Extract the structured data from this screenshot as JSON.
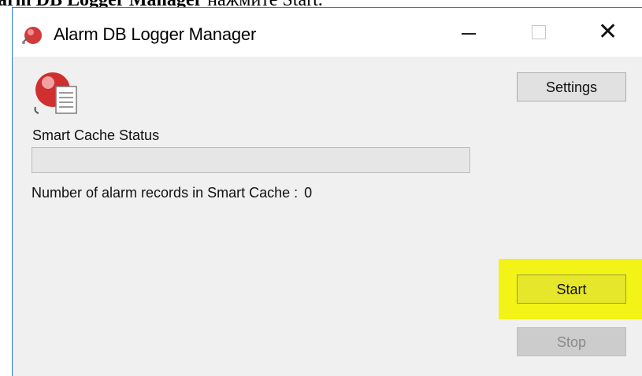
{
  "document": {
    "heading_bold": "arm DB Logger Manager",
    "heading_text": " нажмите Start."
  },
  "window": {
    "title": "Alarm DB Logger Manager",
    "icons": {
      "app": "alarm-bell-icon",
      "client": "alarm-bell-document-icon"
    },
    "controls": {
      "minimize": "minimize-icon",
      "maximize": "maximize-icon",
      "close": "close-icon",
      "close_glyph": "✕"
    }
  },
  "main": {
    "smart_cache_label": "Smart Cache Status",
    "smart_cache_progress": 0,
    "records_label": "Number of alarm records in Smart Cache :",
    "records_value": "0"
  },
  "buttons": {
    "settings": "Settings",
    "start": "Start",
    "stop": "Stop",
    "stop_enabled": false
  },
  "colors": {
    "highlight": "#f3f318",
    "window_bg": "#f0f0f0",
    "accent_border": "#2b79d6"
  }
}
